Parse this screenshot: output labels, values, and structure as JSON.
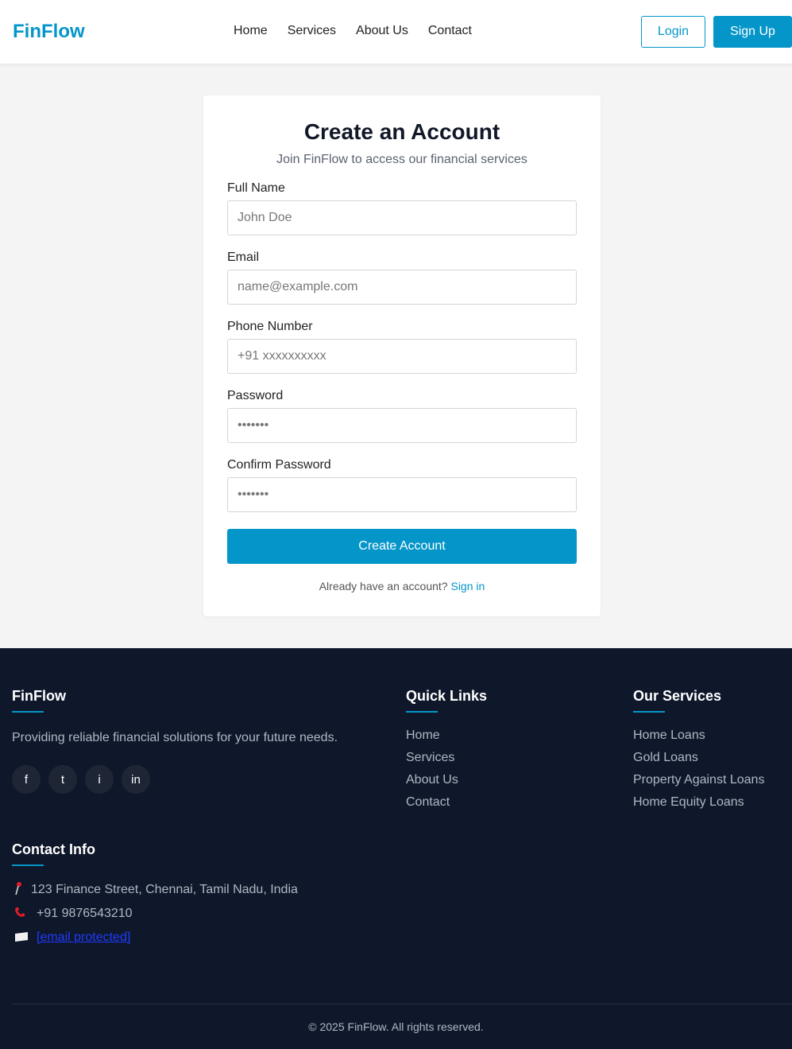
{
  "header": {
    "logo": "FinFlow",
    "nav": [
      "Home",
      "Services",
      "About Us",
      "Contact"
    ],
    "login_label": "Login",
    "signup_label": "Sign Up"
  },
  "form": {
    "title": "Create an Account",
    "subtitle": "Join FinFlow to access our financial services",
    "fields": [
      {
        "label": "Full Name",
        "placeholder": "John Doe",
        "value": ""
      },
      {
        "label": "Email",
        "placeholder": "name@example.com",
        "value": ""
      },
      {
        "label": "Phone Number",
        "placeholder": "+91 xxxxxxxxxx",
        "value": ""
      },
      {
        "label": "Password",
        "placeholder": "•••••••",
        "value": ""
      },
      {
        "label": "Confirm Password",
        "placeholder": "•••••••",
        "value": ""
      }
    ],
    "submit_label": "Create Account",
    "signin_prompt": "Already have an account?",
    "signin_link": "Sign in"
  },
  "footer": {
    "brand": "FinFlow",
    "tagline": "Providing reliable financial solutions for your future needs.",
    "socials": [
      "f",
      "t",
      "i",
      "in"
    ],
    "quick_links_title": "Quick Links",
    "quick_links": [
      "Home",
      "Services",
      "About Us",
      "Contact"
    ],
    "services_title": "Our Services",
    "services": [
      "Home Loans",
      "Gold Loans",
      "Property Against Loans",
      "Home Equity Loans"
    ],
    "contact_title": "Contact Info",
    "address": "123 Finance Street, Chennai, Tamil Nadu, India",
    "phone": "+91 9876543210",
    "email": "[email protected]",
    "copyright": "© 2025 FinFlow. All rights reserved."
  },
  "colors": {
    "brand": "#0596c9",
    "footer_bg": "#0f172a",
    "page_bg": "#f4f4f4"
  },
  "icons": {
    "address": "pin-icon",
    "phone": "phone-icon",
    "email": "envelope-icon"
  }
}
